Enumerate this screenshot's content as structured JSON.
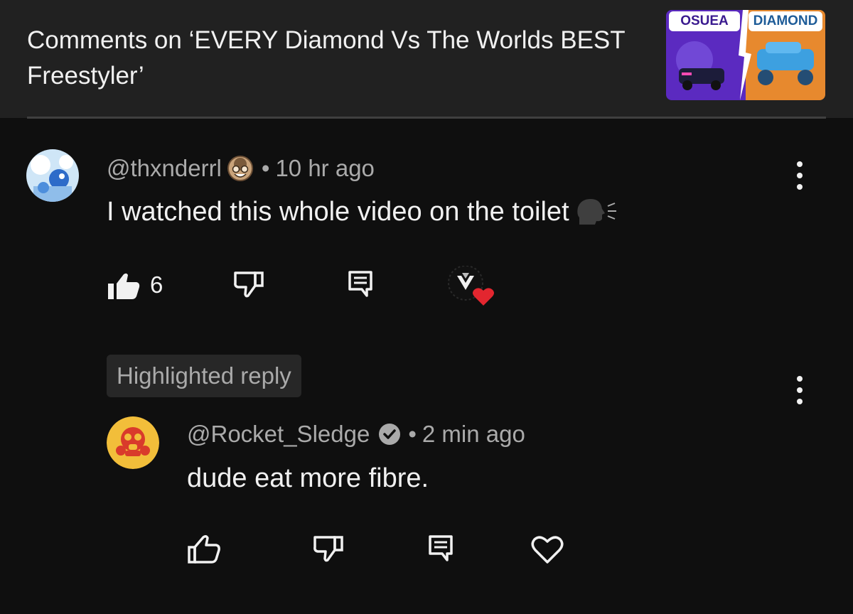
{
  "header": {
    "title": "Comments on ‘EVERY Diamond Vs The Worlds BEST Freestyler’",
    "thumbnail": {
      "left_label": "OSUEA",
      "right_label": "DIAMOND"
    }
  },
  "comment": {
    "handle": "@thxnderrl",
    "separator": "•",
    "time": "10 hr ago",
    "text": "I watched this whole video on the toilet",
    "like_count": "6",
    "creator_heart": true
  },
  "highlight_badge": "Highlighted reply",
  "reply": {
    "handle": "@Rocket_Sledge",
    "verified": true,
    "separator": "•",
    "time": "2 min ago",
    "text": "dude eat more fibre."
  },
  "colors": {
    "background": "#0f0f0f",
    "header": "#212121",
    "secondary_text": "#aaaaaa",
    "heart": "#e3262f"
  },
  "icons": [
    "thumbs-up-icon",
    "thumbs-down-icon",
    "reply-icon",
    "heart-icon",
    "more-vert-icon",
    "verified-icon",
    "speaking-head-icon"
  ]
}
